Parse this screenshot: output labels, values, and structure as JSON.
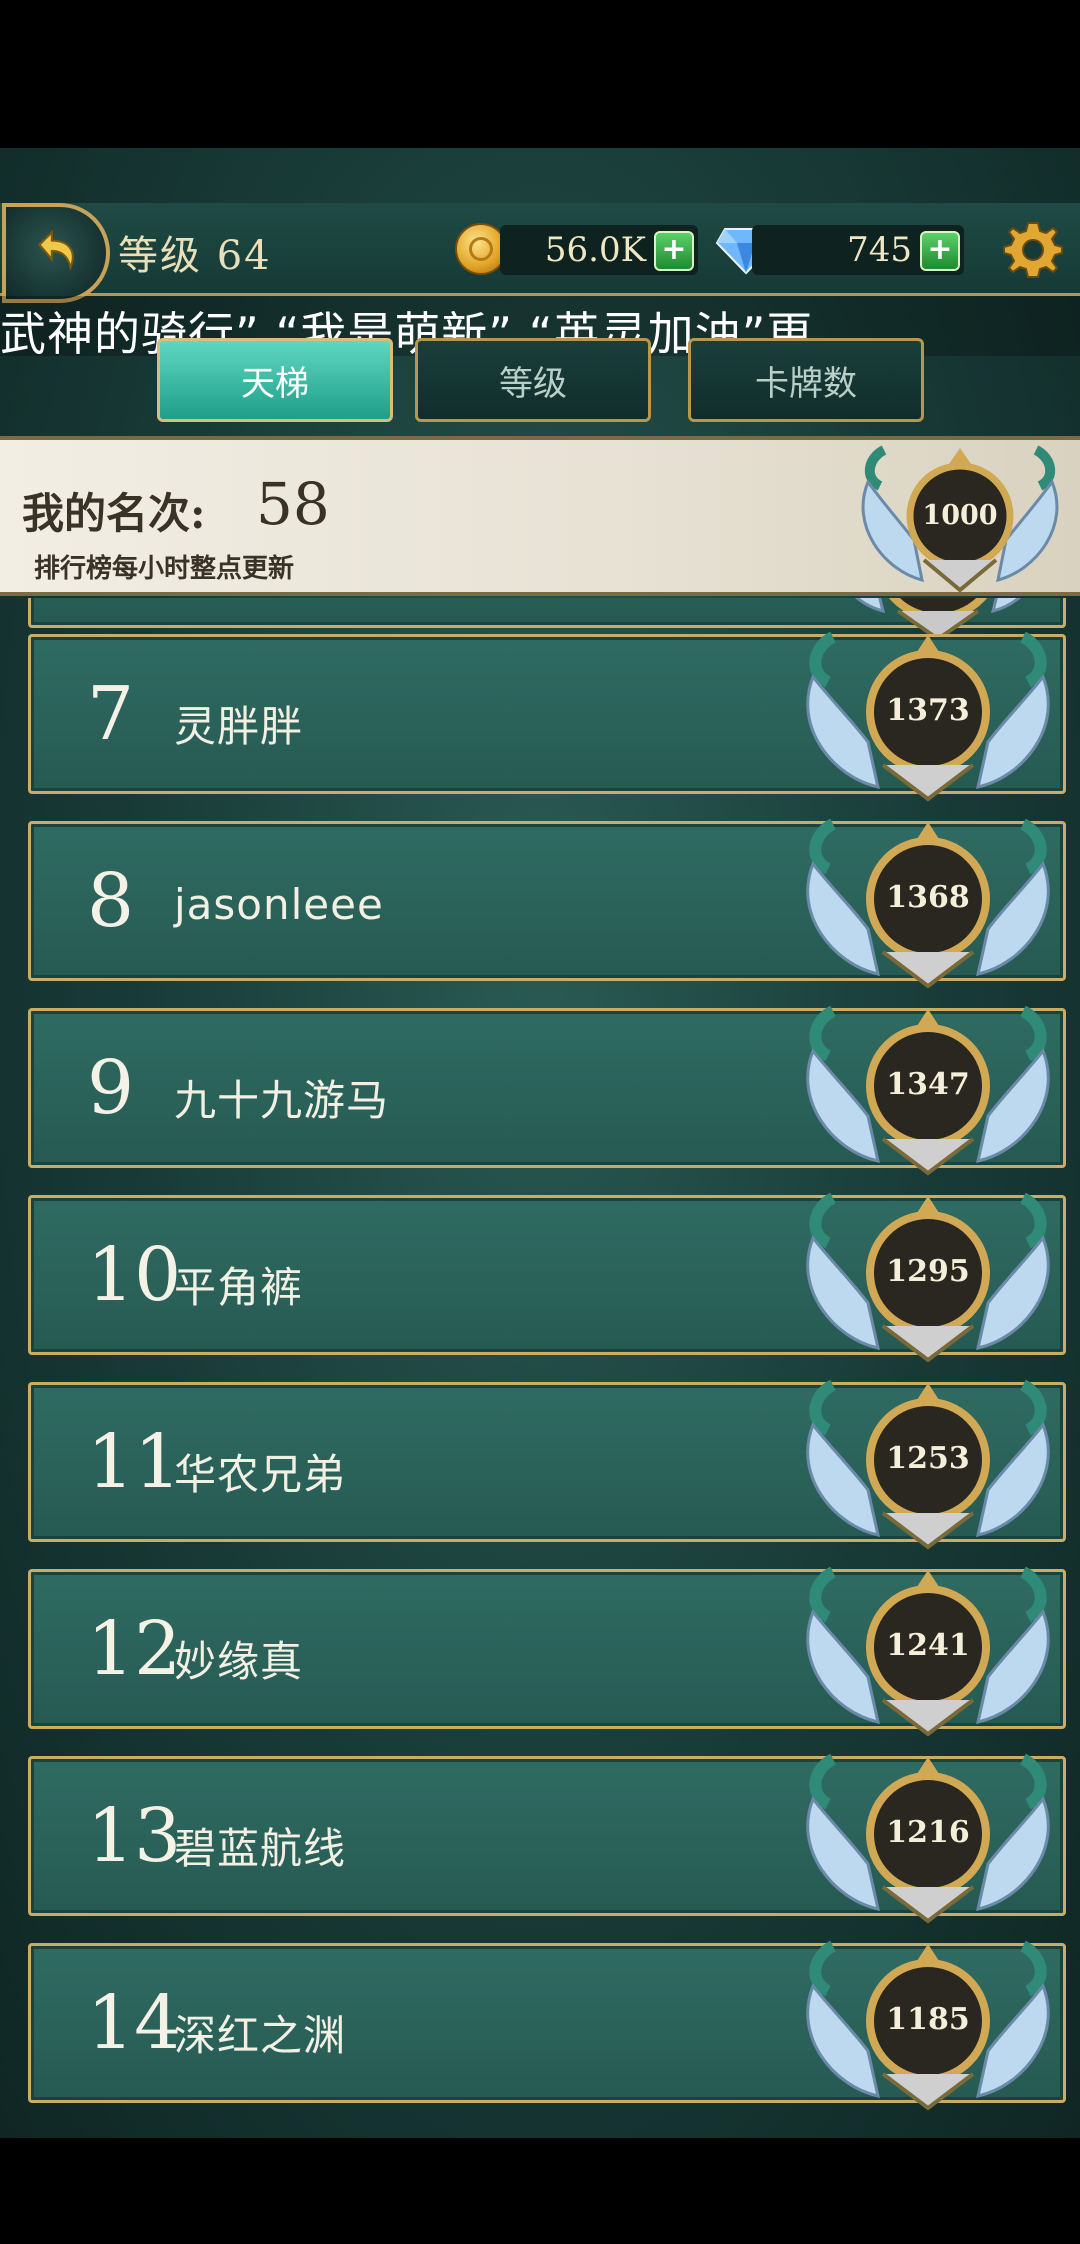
{
  "header": {
    "level_label": "等级 64",
    "coins": "56.0K",
    "gems": "745",
    "plus_symbol": "+"
  },
  "marquee": {
    "text": "武神的骑行”  “我是萌新”  “英灵加油”更"
  },
  "tabs": [
    {
      "label": "天梯",
      "active": true
    },
    {
      "label": "等级",
      "active": false
    },
    {
      "label": "卡牌数",
      "active": false
    }
  ],
  "my_rank": {
    "label": "我的名次:",
    "value": "58",
    "note": "排行榜每小时整点更新",
    "score": "1000"
  },
  "leaderboard": [
    {
      "rank": "7",
      "name": "灵胖胖",
      "score": "1373"
    },
    {
      "rank": "8",
      "name": "jasonleee",
      "score": "1368"
    },
    {
      "rank": "9",
      "name": "九十九游马",
      "score": "1347"
    },
    {
      "rank": "10",
      "name": "平角裤",
      "score": "1295"
    },
    {
      "rank": "11",
      "name": "华农兄弟",
      "score": "1253"
    },
    {
      "rank": "12",
      "name": "妙缘真",
      "score": "1241"
    },
    {
      "rank": "13",
      "name": "碧蓝航线",
      "score": "1216"
    },
    {
      "rank": "14",
      "name": "深红之渊",
      "score": "1185"
    }
  ],
  "colors": {
    "accent": "#c9ad66",
    "row_bg": "#2f6b62",
    "tab_active": "#3fbfa8"
  }
}
